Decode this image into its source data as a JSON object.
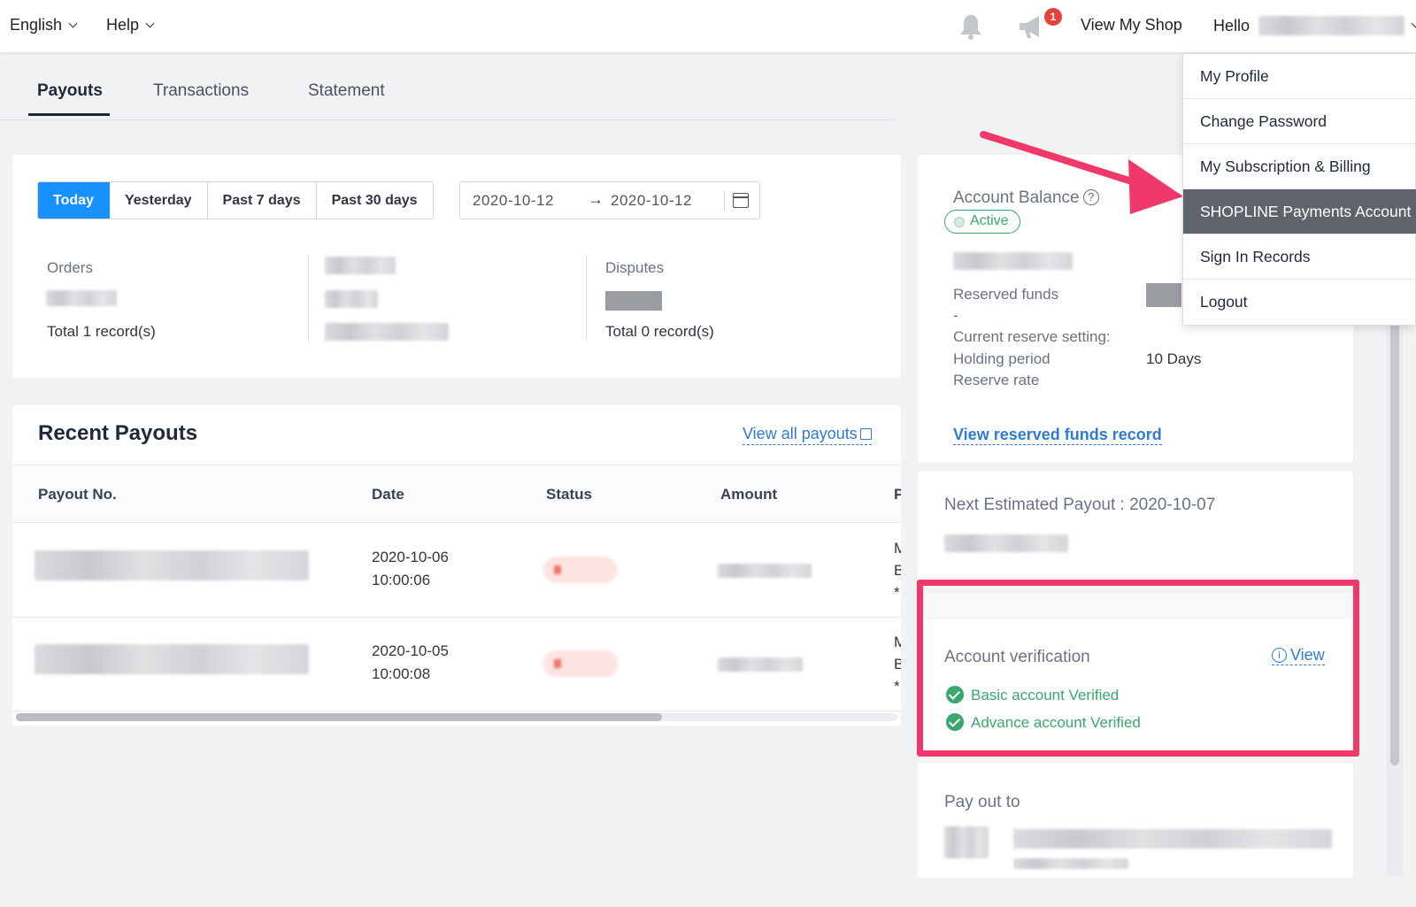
{
  "topbar": {
    "language": "English",
    "help": "Help",
    "view_shop": "View My Shop",
    "hello": "Hello",
    "notification_count": "1"
  },
  "tabs": [
    {
      "label": "Payouts",
      "active": true
    },
    {
      "label": "Transactions",
      "active": false
    },
    {
      "label": "Statement",
      "active": false
    }
  ],
  "filters": {
    "ranges": [
      "Today",
      "Yesterday",
      "Past 7 days",
      "Past 30 days"
    ],
    "selected": "Today",
    "date_from": "2020-10-12",
    "date_to": "2020-10-12"
  },
  "summary": {
    "orders_label": "Orders",
    "orders_total": "Total 1 record(s)",
    "disputes_label": "Disputes",
    "disputes_total": "Total 0 record(s)"
  },
  "recent_payouts": {
    "title": "Recent Payouts",
    "view_all": "View all payouts",
    "columns": [
      "Payout No.",
      "Date",
      "Status",
      "Amount",
      "P"
    ],
    "rows": [
      {
        "date": "2020-10-06",
        "time": "10:00:06",
        "p_col": [
          "M",
          "B",
          "*"
        ]
      },
      {
        "date": "2020-10-05",
        "time": "10:00:08",
        "p_col": [
          "M",
          "B",
          "*"
        ]
      }
    ]
  },
  "balance": {
    "title": "Account Balance",
    "status": "Active",
    "reserved_funds_label": "Reserved funds",
    "reserved_funds_value": "-",
    "reserve_setting_label": "Current reserve setting:",
    "holding_period_label": "Holding period",
    "holding_period_value": "10 Days",
    "reserve_rate_label": "Reserve rate",
    "reserved_link": "View reserved funds record"
  },
  "next_payout": {
    "label": "Next Estimated Payout : 2020-10-07"
  },
  "verification": {
    "title": "Account verification",
    "view": "View",
    "items": [
      "Basic account Verified",
      "Advance account Verified"
    ]
  },
  "payout_to": {
    "label": "Pay out to"
  },
  "user_menu": {
    "items": [
      "My Profile",
      "Change Password",
      "My Subscription & Billing",
      "SHOPLINE Payments Account",
      "Sign In Records",
      "Logout"
    ],
    "highlighted": "SHOPLINE Payments Account"
  },
  "colors": {
    "primary": "#1890ff",
    "link": "#2e7bd6",
    "success": "#3aa76d",
    "annotation": "#f0386b"
  }
}
